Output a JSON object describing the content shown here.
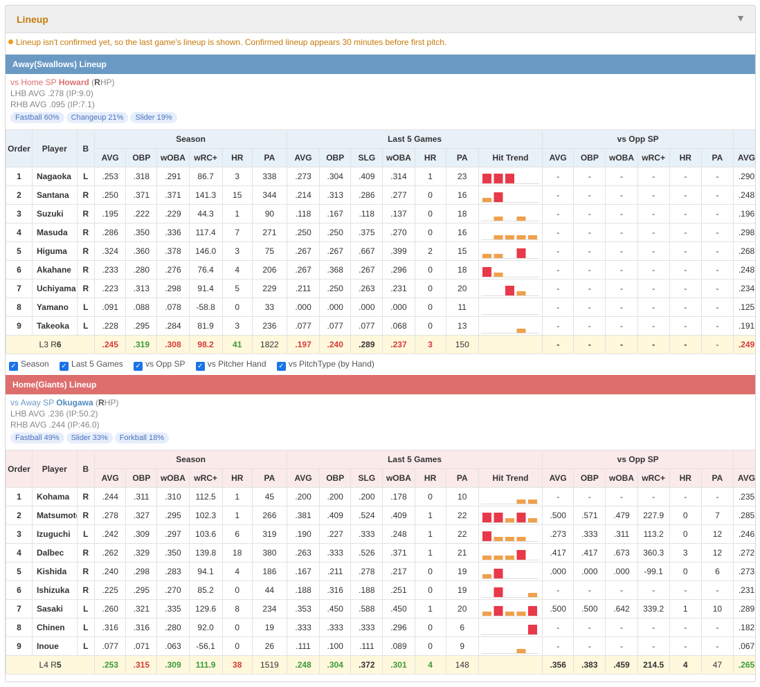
{
  "panel": {
    "title": "Lineup",
    "notice": "Lineup isn't confirmed yet, so the last game's lineup is shown. Confirmed lineup appears 30 minutes before first pitch."
  },
  "headers": {
    "order": "Order",
    "player": "Player",
    "bat": "B",
    "groups": [
      "Season",
      "Last 5 Games",
      "vs Opp SP"
    ],
    "season_cols": [
      "AVG",
      "OBP",
      "wOBA",
      "wRC+",
      "HR",
      "PA"
    ],
    "last5_cols": [
      "AVG",
      "OBP",
      "SLG",
      "wOBA",
      "HR",
      "PA",
      "Hit Trend"
    ],
    "opp_cols": [
      "AVG",
      "OBP",
      "wOBA",
      "wRC+",
      "HR",
      "PA"
    ],
    "extra_col": "AVG"
  },
  "filters": [
    "Season",
    "Last 5 Games",
    "vs Opp SP",
    "vs Pitcher Hand",
    "vs PitchType (by Hand)"
  ],
  "colors": {
    "away": "#6a9ac4",
    "home": "#dd6e6e",
    "trend_hit": "#e8384a",
    "trend_out": "#f0a04a"
  },
  "away": {
    "title": "Away(Swallows) Lineup",
    "sp_prefix": "vs Home SP",
    "sp_name": "Howard",
    "sp_hand": "R",
    "sp_hand_suffix": "HP",
    "lhb": "LHB AVG .278 (IP:9.0)",
    "rhb": "RHB AVG .095 (IP:7.1)",
    "pitches": [
      "Fastball 60%",
      "Changeup 21%",
      "Slider 19%"
    ],
    "rows": [
      {
        "order": "1",
        "name": "Nagaoka",
        "bat": "L",
        "season": [
          ".253",
          ".318",
          ".291",
          "86.7",
          "3",
          "338"
        ],
        "last5": [
          ".273",
          ".304",
          ".409",
          ".314",
          "1",
          "23"
        ],
        "trend": [
          "h",
          "h",
          "h",
          "",
          ""
        ],
        "opp": [
          "-",
          "-",
          "-",
          "-",
          "-",
          "-"
        ],
        "extra": ".290"
      },
      {
        "order": "2",
        "name": "Santana",
        "bat": "R",
        "season": [
          ".250",
          ".371",
          ".371",
          "141.3",
          "15",
          "344"
        ],
        "last5": [
          ".214",
          ".313",
          ".286",
          ".277",
          "0",
          "16"
        ],
        "trend": [
          "o",
          "h",
          "",
          "",
          ""
        ],
        "opp": [
          "-",
          "-",
          "-",
          "-",
          "-",
          "-"
        ],
        "extra": ".248"
      },
      {
        "order": "3",
        "name": "Suzuki",
        "bat": "R",
        "season": [
          ".195",
          ".222",
          ".229",
          "44.3",
          "1",
          "90"
        ],
        "last5": [
          ".118",
          ".167",
          ".118",
          ".137",
          "0",
          "18"
        ],
        "trend": [
          "",
          "o",
          "",
          "o",
          ""
        ],
        "opp": [
          "-",
          "-",
          "-",
          "-",
          "-",
          "-"
        ],
        "extra": ".196"
      },
      {
        "order": "4",
        "name": "Masuda",
        "bat": "R",
        "season": [
          ".286",
          ".350",
          ".336",
          "117.4",
          "7",
          "271"
        ],
        "last5": [
          ".250",
          ".250",
          ".375",
          ".270",
          "0",
          "16"
        ],
        "trend": [
          "",
          "o",
          "o",
          "o",
          "o"
        ],
        "opp": [
          "-",
          "-",
          "-",
          "-",
          "-",
          "-"
        ],
        "extra": ".298"
      },
      {
        "order": "5",
        "name": "Higuma",
        "bat": "R",
        "season": [
          ".324",
          ".360",
          ".378",
          "146.0",
          "3",
          "75"
        ],
        "last5": [
          ".267",
          ".267",
          ".667",
          ".399",
          "2",
          "15"
        ],
        "trend": [
          "o",
          "o",
          "",
          "h",
          ""
        ],
        "opp": [
          "-",
          "-",
          "-",
          "-",
          "-",
          "-"
        ],
        "extra": ".268"
      },
      {
        "order": "6",
        "name": "Akahane",
        "bat": "R",
        "season": [
          ".233",
          ".280",
          ".276",
          "76.4",
          "4",
          "206"
        ],
        "last5": [
          ".267",
          ".368",
          ".267",
          ".296",
          "0",
          "18"
        ],
        "trend": [
          "h",
          "o",
          "",
          "",
          ""
        ],
        "opp": [
          "-",
          "-",
          "-",
          "-",
          "-",
          "-"
        ],
        "extra": ".248"
      },
      {
        "order": "7",
        "name": "Uchiyama",
        "bat": "R",
        "season": [
          ".223",
          ".313",
          ".298",
          "91.4",
          "5",
          "229"
        ],
        "last5": [
          ".211",
          ".250",
          ".263",
          ".231",
          "0",
          "20"
        ],
        "trend": [
          "",
          "",
          "h",
          "o",
          ""
        ],
        "opp": [
          "-",
          "-",
          "-",
          "-",
          "-",
          "-"
        ],
        "extra": ".234"
      },
      {
        "order": "8",
        "name": "Yamano",
        "bat": "L",
        "season": [
          ".091",
          ".088",
          ".078",
          "-58.8",
          "0",
          "33"
        ],
        "last5": [
          ".000",
          ".000",
          ".000",
          ".000",
          "0",
          "11"
        ],
        "trend": [
          "",
          "",
          "",
          "",
          ""
        ],
        "opp": [
          "-",
          "-",
          "-",
          "-",
          "-",
          "-"
        ],
        "extra": ".125"
      },
      {
        "order": "9",
        "name": "Takeoka",
        "bat": "L",
        "season": [
          ".228",
          ".295",
          ".284",
          "81.9",
          "3",
          "236"
        ],
        "last5": [
          ".077",
          ".077",
          ".077",
          ".068",
          "0",
          "13"
        ],
        "trend": [
          "",
          "",
          "",
          "o",
          ""
        ],
        "opp": [
          "-",
          "-",
          "-",
          "-",
          "-",
          "-"
        ],
        "extra": ".191"
      }
    ],
    "total": {
      "label_l": "L3",
      "label_r": "R",
      "label_rn": "6",
      "season": [
        ".245",
        ".319",
        ".308",
        "98.2",
        "41",
        "1822"
      ],
      "last5": [
        ".197",
        ".240",
        ".289",
        ".237",
        "3",
        "150"
      ],
      "opp": [
        "-",
        "-",
        "-",
        "-",
        "-",
        "-"
      ],
      "extra": ".249"
    }
  },
  "home": {
    "title": "Home(Giants) Lineup",
    "sp_prefix": "vs Away SP",
    "sp_name": "Okugawa",
    "sp_hand": "R",
    "sp_hand_suffix": "HP",
    "lhb": "LHB AVG .236 (IP:50.2)",
    "rhb": "RHB AVG .244 (IP:46.0)",
    "pitches": [
      "Fastball 49%",
      "Slider 33%",
      "Forkball 18%"
    ],
    "rows": [
      {
        "order": "1",
        "name": "Kohama",
        "bat": "R",
        "season": [
          ".244",
          ".311",
          ".310",
          "112.5",
          "1",
          "45"
        ],
        "last5": [
          ".200",
          ".200",
          ".200",
          ".178",
          "0",
          "10"
        ],
        "trend": [
          "",
          "",
          "",
          "o",
          "o"
        ],
        "opp": [
          "-",
          "-",
          "-",
          "-",
          "-",
          "-"
        ],
        "extra": ".235"
      },
      {
        "order": "2",
        "name": "Matsumoto",
        "bat": "R",
        "season": [
          ".278",
          ".327",
          ".295",
          "102.3",
          "1",
          "266"
        ],
        "last5": [
          ".381",
          ".409",
          ".524",
          ".409",
          "1",
          "22"
        ],
        "trend": [
          "h",
          "h",
          "o",
          "h",
          "o"
        ],
        "opp": [
          ".500",
          ".571",
          ".479",
          "227.9",
          "0",
          "7"
        ],
        "extra": ".285"
      },
      {
        "order": "3",
        "name": "Izuguchi",
        "bat": "L",
        "season": [
          ".242",
          ".309",
          ".297",
          "103.6",
          "6",
          "319"
        ],
        "last5": [
          ".190",
          ".227",
          ".333",
          ".248",
          "1",
          "22"
        ],
        "trend": [
          "h",
          "o",
          "o",
          "o",
          ""
        ],
        "opp": [
          ".273",
          ".333",
          ".311",
          "113.2",
          "0",
          "12"
        ],
        "extra": ".246"
      },
      {
        "order": "4",
        "name": "Dalbec",
        "bat": "R",
        "season": [
          ".262",
          ".329",
          ".350",
          "139.8",
          "18",
          "380"
        ],
        "last5": [
          ".263",
          ".333",
          ".526",
          ".371",
          "1",
          "21"
        ],
        "trend": [
          "o",
          "o",
          "o",
          "h",
          ""
        ],
        "opp": [
          ".417",
          ".417",
          ".673",
          "360.3",
          "3",
          "12"
        ],
        "extra": ".272"
      },
      {
        "order": "5",
        "name": "Kishida",
        "bat": "R",
        "season": [
          ".240",
          ".298",
          ".283",
          "94.1",
          "4",
          "186"
        ],
        "last5": [
          ".167",
          ".211",
          ".278",
          ".217",
          "0",
          "19"
        ],
        "trend": [
          "o",
          "h",
          "",
          "",
          ""
        ],
        "opp": [
          ".000",
          ".000",
          ".000",
          "-99.1",
          "0",
          "6"
        ],
        "extra": ".273"
      },
      {
        "order": "6",
        "name": "Ishizuka",
        "bat": "R",
        "season": [
          ".225",
          ".295",
          ".270",
          "85.2",
          "0",
          "44"
        ],
        "last5": [
          ".188",
          ".316",
          ".188",
          ".251",
          "0",
          "19"
        ],
        "trend": [
          "",
          "h",
          "",
          "",
          "o"
        ],
        "opp": [
          "-",
          "-",
          "-",
          "-",
          "-",
          "-"
        ],
        "extra": ".231"
      },
      {
        "order": "7",
        "name": "Sasaki",
        "bat": "L",
        "season": [
          ".260",
          ".321",
          ".335",
          "129.6",
          "8",
          "234"
        ],
        "last5": [
          ".353",
          ".450",
          ".588",
          ".450",
          "1",
          "20"
        ],
        "trend": [
          "o",
          "h",
          "o",
          "o",
          "h"
        ],
        "opp": [
          ".500",
          ".500",
          ".642",
          "339.2",
          "1",
          "10"
        ],
        "extra": ".289"
      },
      {
        "order": "8",
        "name": "Chinen",
        "bat": "L",
        "season": [
          ".316",
          ".316",
          ".280",
          "92.0",
          "0",
          "19"
        ],
        "last5": [
          ".333",
          ".333",
          ".333",
          ".296",
          "0",
          "6"
        ],
        "trend": [
          "",
          "",
          "",
          "",
          "h"
        ],
        "opp": [
          "-",
          "-",
          "-",
          "-",
          "-",
          "-"
        ],
        "extra": ".182"
      },
      {
        "order": "9",
        "name": "Inoue",
        "bat": "L",
        "season": [
          ".077",
          ".071",
          ".063",
          "-56.1",
          "0",
          "26"
        ],
        "last5": [
          ".111",
          ".100",
          ".111",
          ".089",
          "0",
          "9"
        ],
        "trend": [
          "",
          "",
          "",
          "o",
          ""
        ],
        "opp": [
          "-",
          "-",
          "-",
          "-",
          "-",
          "-"
        ],
        "extra": ".067"
      }
    ],
    "total": {
      "label_l": "L4",
      "label_r": "R",
      "label_rn": "5",
      "season": [
        ".253",
        ".315",
        ".309",
        "111.9",
        "38",
        "1519"
      ],
      "last5": [
        ".248",
        ".304",
        ".372",
        ".301",
        "4",
        "148"
      ],
      "opp": [
        ".356",
        ".383",
        ".459",
        "214.5",
        "4",
        "47"
      ],
      "extra": ".265"
    }
  }
}
